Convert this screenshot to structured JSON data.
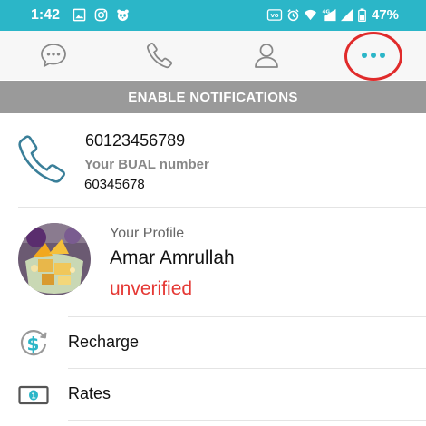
{
  "status_bar": {
    "time": "1:42",
    "battery": "47%",
    "icons": [
      "gallery-icon",
      "instagram-icon",
      "panda-icon",
      "volte-icon",
      "alarm-icon",
      "wifi-icon",
      "lte-icon",
      "signal-icon",
      "battery-icon"
    ]
  },
  "tabs": [
    {
      "name": "chat",
      "icon": "chat-bubble-icon"
    },
    {
      "name": "calls",
      "icon": "phone-icon"
    },
    {
      "name": "contacts",
      "icon": "person-icon"
    },
    {
      "name": "more",
      "icon": "more-dots-icon",
      "selected": true
    }
  ],
  "banner": {
    "label": "ENABLE NOTIFICATIONS"
  },
  "phone": {
    "number": "60123456789",
    "bual_label": "Your BUAL number",
    "bual_number": "60345678"
  },
  "profile": {
    "caption": "Your Profile",
    "name": "Amar Amrullah",
    "status": "unverified"
  },
  "menu": [
    {
      "label": "Recharge",
      "icon": "recharge-dollar-icon"
    },
    {
      "label": "Rates",
      "icon": "rates-cash-icon"
    }
  ],
  "colors": {
    "accent": "#2bb6c8",
    "banner": "#9a9a9a",
    "unverified": "#e53935",
    "highlight": "#e02b2b"
  }
}
